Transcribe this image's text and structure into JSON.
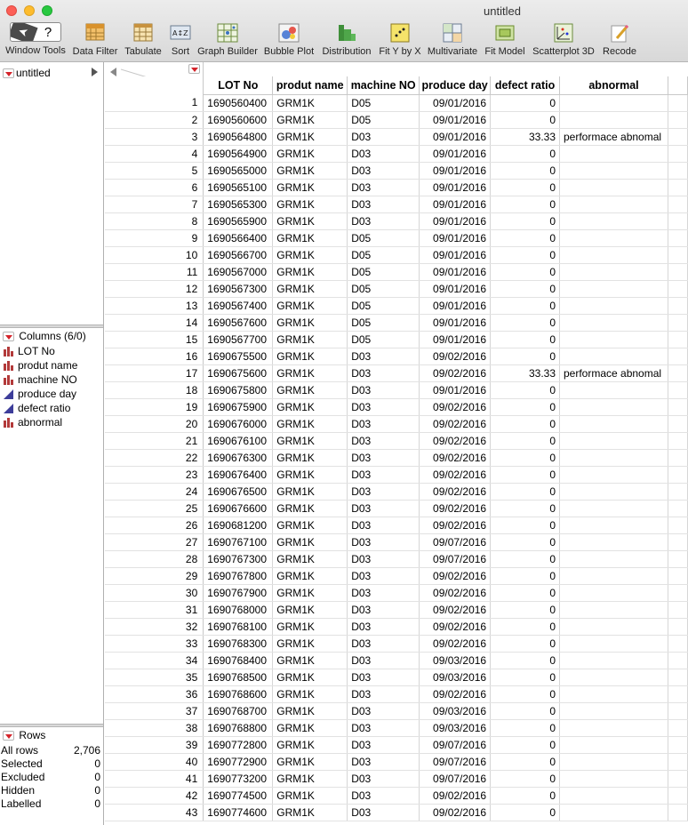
{
  "window": {
    "title": "untitled"
  },
  "toolbar": [
    {
      "name": "window-tools",
      "label": "Window Tools"
    },
    {
      "name": "data-filter",
      "label": "Data Filter"
    },
    {
      "name": "tabulate",
      "label": "Tabulate"
    },
    {
      "name": "sort",
      "label": "Sort"
    },
    {
      "name": "graph-builder",
      "label": "Graph Builder"
    },
    {
      "name": "bubble-plot",
      "label": "Bubble Plot"
    },
    {
      "name": "distribution",
      "label": "Distribution"
    },
    {
      "name": "fit-y-by-x",
      "label": "Fit Y by X"
    },
    {
      "name": "multivariate",
      "label": "Multivariate"
    },
    {
      "name": "fit-model",
      "label": "Fit Model"
    },
    {
      "name": "scatterplot-3d",
      "label": "Scatterplot 3D"
    },
    {
      "name": "recode",
      "label": "Recode"
    }
  ],
  "window_tools": {
    "pointer": "➤",
    "help": "?"
  },
  "table_panel": {
    "name": "untitled"
  },
  "columns_panel": {
    "title": "Columns (6/0)",
    "items": [
      {
        "label": "LOT No",
        "icon": "nominal-icon"
      },
      {
        "label": "produt name",
        "icon": "nominal-icon"
      },
      {
        "label": "machine NO",
        "icon": "nominal-icon"
      },
      {
        "label": "produce day",
        "icon": "continuous-icon"
      },
      {
        "label": "defect ratio",
        "icon": "continuous-icon"
      },
      {
        "label": "abnormal",
        "icon": "nominal-icon"
      }
    ]
  },
  "rows_panel": {
    "title": "Rows",
    "stats": [
      {
        "label": "All rows",
        "value": "2,706"
      },
      {
        "label": "Selected",
        "value": "0"
      },
      {
        "label": "Excluded",
        "value": "0"
      },
      {
        "label": "Hidden",
        "value": "0"
      },
      {
        "label": "Labelled",
        "value": "0"
      }
    ]
  },
  "columns": [
    "LOT No",
    "produt name",
    "machine NO",
    "produce day",
    "defect ratio",
    "abnormal"
  ],
  "rows": [
    [
      "1",
      "1690560400",
      "GRM1K",
      "D05",
      "09/01/2016",
      "0",
      ""
    ],
    [
      "2",
      "1690560600",
      "GRM1K",
      "D05",
      "09/01/2016",
      "0",
      ""
    ],
    [
      "3",
      "1690564800",
      "GRM1K",
      "D03",
      "09/01/2016",
      "33.33",
      "performace abnomal"
    ],
    [
      "4",
      "1690564900",
      "GRM1K",
      "D03",
      "09/01/2016",
      "0",
      ""
    ],
    [
      "5",
      "1690565000",
      "GRM1K",
      "D03",
      "09/01/2016",
      "0",
      ""
    ],
    [
      "6",
      "1690565100",
      "GRM1K",
      "D03",
      "09/01/2016",
      "0",
      ""
    ],
    [
      "7",
      "1690565300",
      "GRM1K",
      "D03",
      "09/01/2016",
      "0",
      ""
    ],
    [
      "8",
      "1690565900",
      "GRM1K",
      "D03",
      "09/01/2016",
      "0",
      ""
    ],
    [
      "9",
      "1690566400",
      "GRM1K",
      "D05",
      "09/01/2016",
      "0",
      ""
    ],
    [
      "10",
      "1690566700",
      "GRM1K",
      "D05",
      "09/01/2016",
      "0",
      ""
    ],
    [
      "11",
      "1690567000",
      "GRM1K",
      "D05",
      "09/01/2016",
      "0",
      ""
    ],
    [
      "12",
      "1690567300",
      "GRM1K",
      "D05",
      "09/01/2016",
      "0",
      ""
    ],
    [
      "13",
      "1690567400",
      "GRM1K",
      "D05",
      "09/01/2016",
      "0",
      ""
    ],
    [
      "14",
      "1690567600",
      "GRM1K",
      "D05",
      "09/01/2016",
      "0",
      ""
    ],
    [
      "15",
      "1690567700",
      "GRM1K",
      "D05",
      "09/01/2016",
      "0",
      ""
    ],
    [
      "16",
      "1690675500",
      "GRM1K",
      "D03",
      "09/02/2016",
      "0",
      ""
    ],
    [
      "17",
      "1690675600",
      "GRM1K",
      "D03",
      "09/02/2016",
      "33.33",
      "performace abnomal"
    ],
    [
      "18",
      "1690675800",
      "GRM1K",
      "D03",
      "09/01/2016",
      "0",
      ""
    ],
    [
      "19",
      "1690675900",
      "GRM1K",
      "D03",
      "09/02/2016",
      "0",
      ""
    ],
    [
      "20",
      "1690676000",
      "GRM1K",
      "D03",
      "09/02/2016",
      "0",
      ""
    ],
    [
      "21",
      "1690676100",
      "GRM1K",
      "D03",
      "09/02/2016",
      "0",
      ""
    ],
    [
      "22",
      "1690676300",
      "GRM1K",
      "D03",
      "09/02/2016",
      "0",
      ""
    ],
    [
      "23",
      "1690676400",
      "GRM1K",
      "D03",
      "09/02/2016",
      "0",
      ""
    ],
    [
      "24",
      "1690676500",
      "GRM1K",
      "D03",
      "09/02/2016",
      "0",
      ""
    ],
    [
      "25",
      "1690676600",
      "GRM1K",
      "D03",
      "09/02/2016",
      "0",
      ""
    ],
    [
      "26",
      "1690681200",
      "GRM1K",
      "D03",
      "09/02/2016",
      "0",
      ""
    ],
    [
      "27",
      "1690767100",
      "GRM1K",
      "D03",
      "09/07/2016",
      "0",
      ""
    ],
    [
      "28",
      "1690767300",
      "GRM1K",
      "D03",
      "09/07/2016",
      "0",
      ""
    ],
    [
      "29",
      "1690767800",
      "GRM1K",
      "D03",
      "09/02/2016",
      "0",
      ""
    ],
    [
      "30",
      "1690767900",
      "GRM1K",
      "D03",
      "09/02/2016",
      "0",
      ""
    ],
    [
      "31",
      "1690768000",
      "GRM1K",
      "D03",
      "09/02/2016",
      "0",
      ""
    ],
    [
      "32",
      "1690768100",
      "GRM1K",
      "D03",
      "09/02/2016",
      "0",
      ""
    ],
    [
      "33",
      "1690768300",
      "GRM1K",
      "D03",
      "09/02/2016",
      "0",
      ""
    ],
    [
      "34",
      "1690768400",
      "GRM1K",
      "D03",
      "09/03/2016",
      "0",
      ""
    ],
    [
      "35",
      "1690768500",
      "GRM1K",
      "D03",
      "09/03/2016",
      "0",
      ""
    ],
    [
      "36",
      "1690768600",
      "GRM1K",
      "D03",
      "09/02/2016",
      "0",
      ""
    ],
    [
      "37",
      "1690768700",
      "GRM1K",
      "D03",
      "09/03/2016",
      "0",
      ""
    ],
    [
      "38",
      "1690768800",
      "GRM1K",
      "D03",
      "09/03/2016",
      "0",
      ""
    ],
    [
      "39",
      "1690772800",
      "GRM1K",
      "D03",
      "09/07/2016",
      "0",
      ""
    ],
    [
      "40",
      "1690772900",
      "GRM1K",
      "D03",
      "09/07/2016",
      "0",
      ""
    ],
    [
      "41",
      "1690773200",
      "GRM1K",
      "D03",
      "09/07/2016",
      "0",
      ""
    ],
    [
      "42",
      "1690774500",
      "GRM1K",
      "D03",
      "09/02/2016",
      "0",
      ""
    ],
    [
      "43",
      "1690774600",
      "GRM1K",
      "D03",
      "09/02/2016",
      "0",
      ""
    ]
  ]
}
